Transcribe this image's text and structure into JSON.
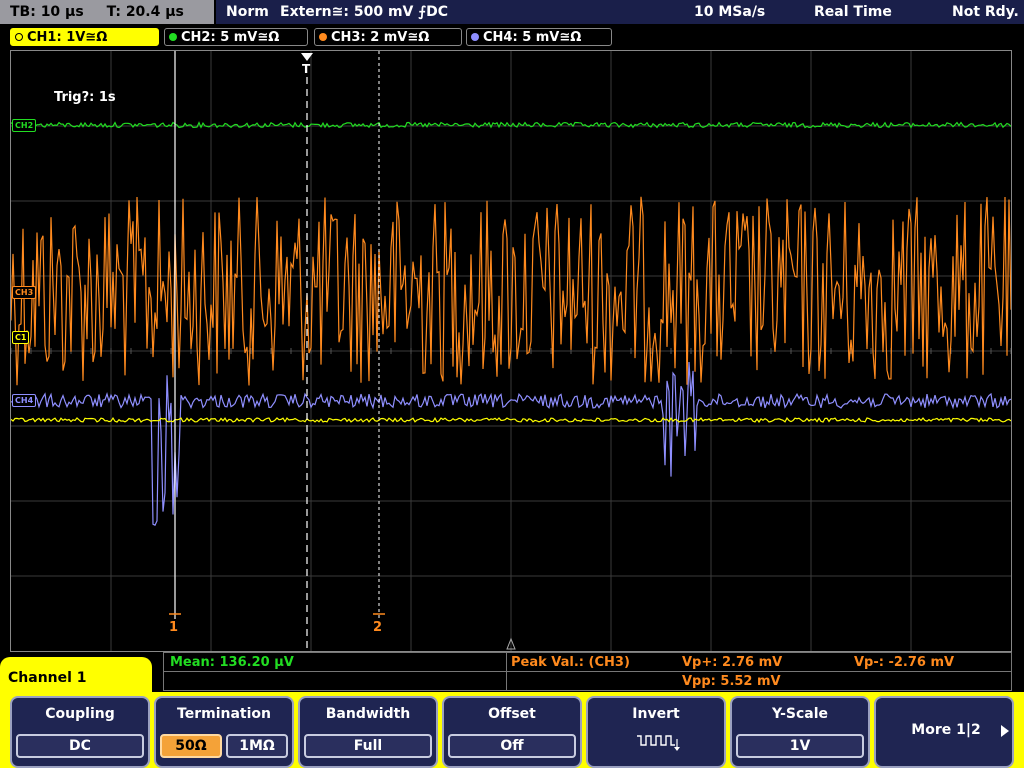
{
  "top_bar": {
    "timebase": "TB: 10 µs",
    "trigger_time": "T: 20.4 µs",
    "mode": "Norm",
    "trigger_source": "Extern≅: 500 mV ⨍DC",
    "sample_rate": "10 MSa/s",
    "acquisition": "Real Time",
    "status": "Not Rdy."
  },
  "channel_tabs": [
    {
      "label": "CH1: 1V≅Ω",
      "color": "#ffff00"
    },
    {
      "label": "CH2: 5 mV≅Ω",
      "color": "#22dd22"
    },
    {
      "label": "CH3: 2 mV≅Ω",
      "color": "#ff8a1e"
    },
    {
      "label": "CH4: 5 mV≅Ω",
      "color": "#8f8fff"
    }
  ],
  "screen": {
    "trigger_label": "Trig?: 1s",
    "trigger_marker": "T",
    "cursor_labels": [
      "1",
      "2"
    ],
    "channel_markers": [
      {
        "label": "CH2",
        "color": "#22dd22"
      },
      {
        "label": "CH3",
        "color": "#ff8a1e"
      },
      {
        "label": "C1",
        "color": "#ffff00"
      },
      {
        "label": "CH4",
        "color": "#8f8fff"
      }
    ]
  },
  "measurements": {
    "mean": "Mean: 136.20 µV",
    "peak_label": "Peak Val.:  (CH3)",
    "vp_plus": "Vp+: 2.76 mV",
    "vp_minus": "Vp-: -2.76 mV",
    "vpp": "Vpp: 5.52 mV"
  },
  "softkeys": {
    "channel_title": "Channel 1",
    "coupling": {
      "title": "Coupling",
      "value": "DC"
    },
    "termination": {
      "title": "Termination",
      "options": [
        "50Ω",
        "1MΩ"
      ]
    },
    "bandwidth": {
      "title": "Bandwidth",
      "value": "Full"
    },
    "offset": {
      "title": "Offset",
      "value": "Off"
    },
    "invert": {
      "title": "Invert"
    },
    "y_scale": {
      "title": "Y-Scale",
      "value": "1V"
    },
    "more": {
      "label": "More 1|2"
    }
  },
  "colors": {
    "ch1": "#ffff00",
    "ch2": "#22dd22",
    "ch3": "#ff8a1e",
    "ch4": "#8f8fff",
    "softkey_bg": "#1f2552"
  }
}
